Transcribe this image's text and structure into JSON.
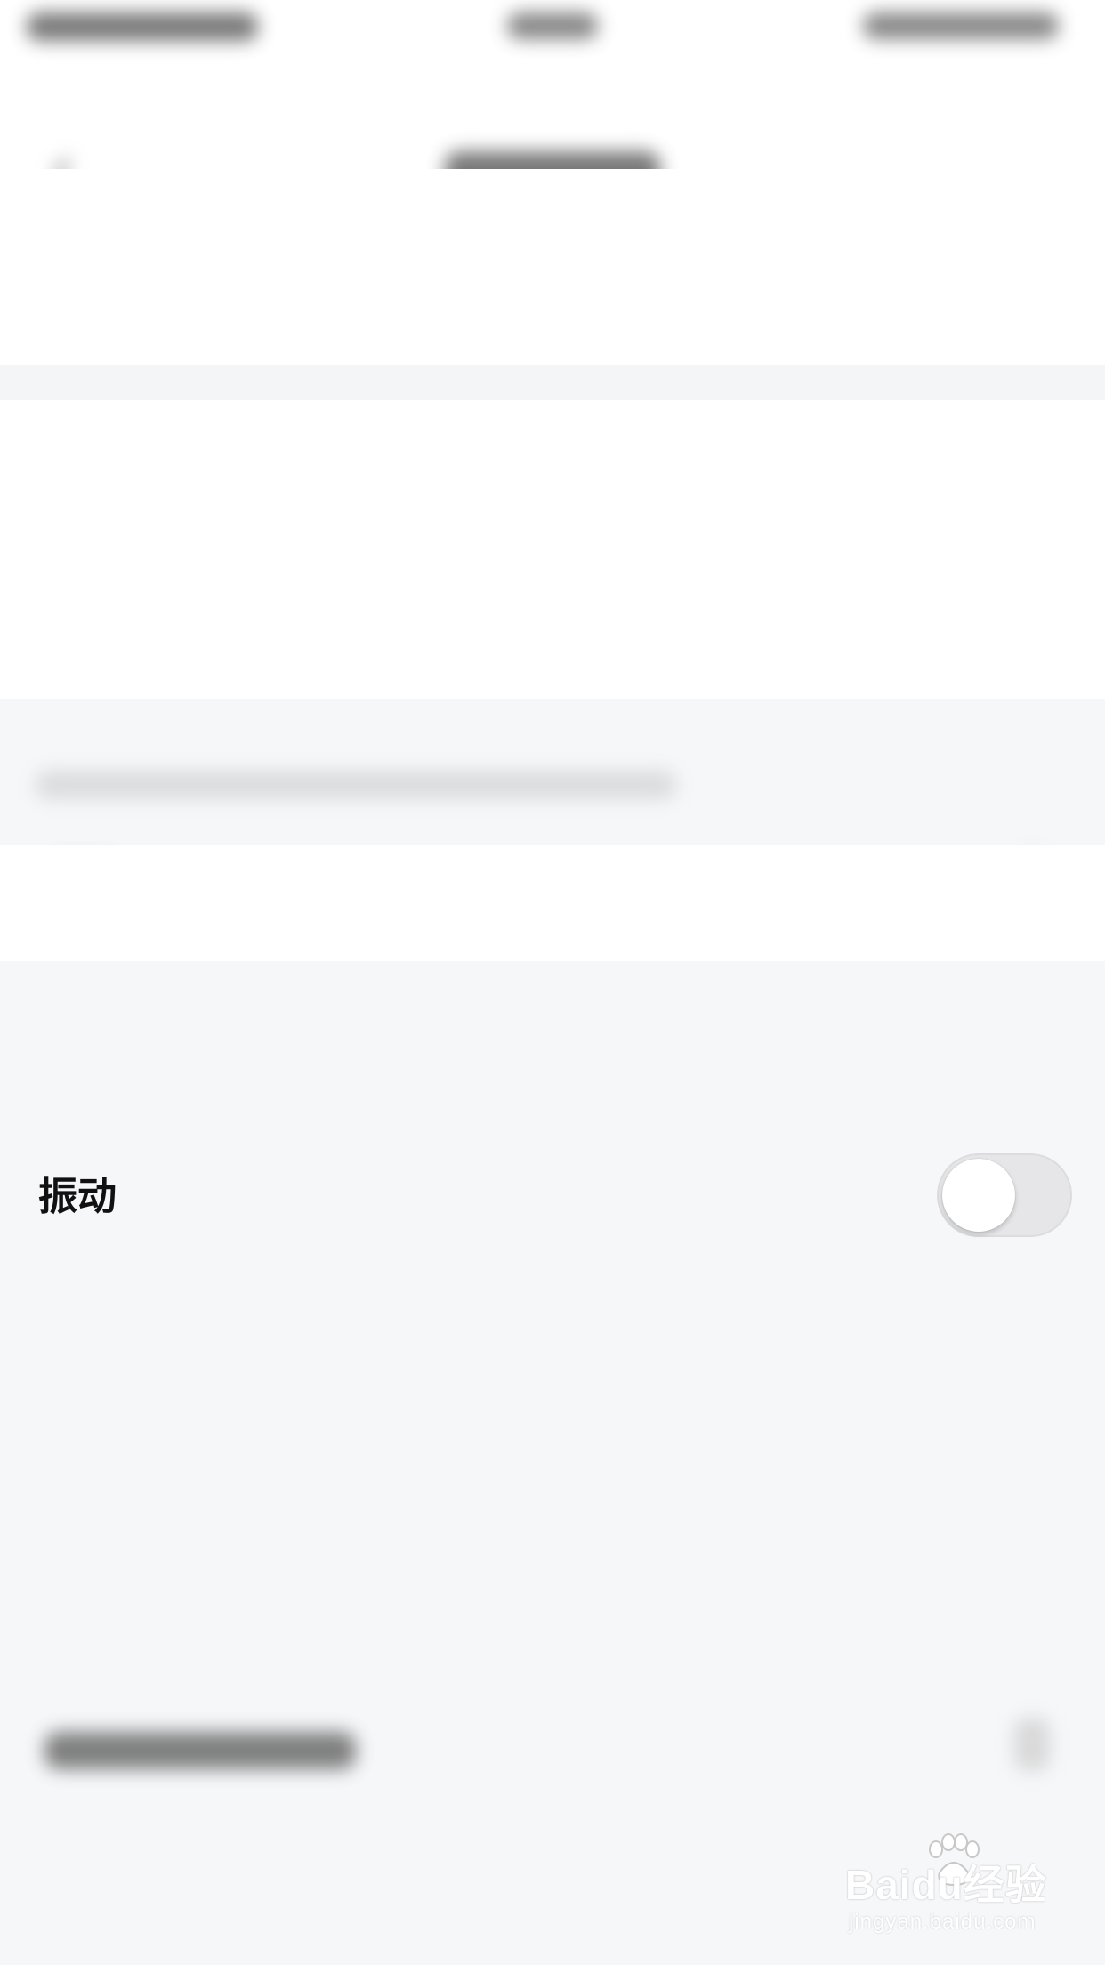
{
  "settings": {
    "vibrate_label": "振动",
    "vibrate_enabled": false
  },
  "watermark": {
    "brand": "Baidu经验",
    "url": "jingyan.baidu.com"
  },
  "icons": {
    "back": "chevron-left-icon",
    "toggle": "toggle-switch",
    "watermark_logo": "paw-icon"
  },
  "colors": {
    "background": "#f6f7f9",
    "card": "#ffffff",
    "toggle_off": "#e6e6e9",
    "text": "#111111"
  }
}
